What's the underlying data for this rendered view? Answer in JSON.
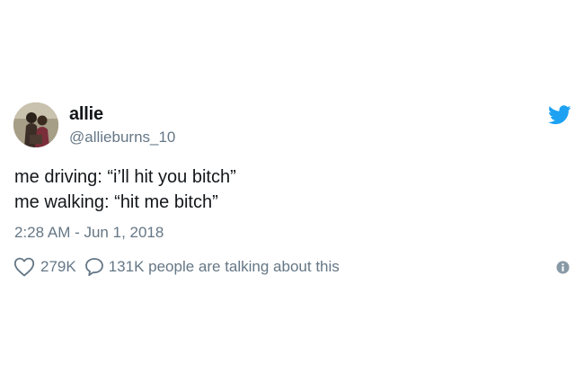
{
  "tweet": {
    "author": {
      "display_name": "allie",
      "handle": "@allieburns_10",
      "avatar_icon": "profile-photo"
    },
    "text_lines": [
      "me driving: “i’ll hit you bitch”",
      "me walking: “hit me bitch”"
    ],
    "timestamp": "2:28 AM - Jun 1, 2018",
    "likes": {
      "icon": "heart-icon",
      "count": "279K"
    },
    "replies": {
      "icon": "speech-bubble-icon",
      "label": "131K people are talking about this"
    },
    "info_icon": "info-icon",
    "brand": {
      "icon": "twitter-bird-icon",
      "color": "#1da1f2"
    },
    "colors": {
      "primary_text": "#14171a",
      "secondary_text": "#657786"
    }
  }
}
